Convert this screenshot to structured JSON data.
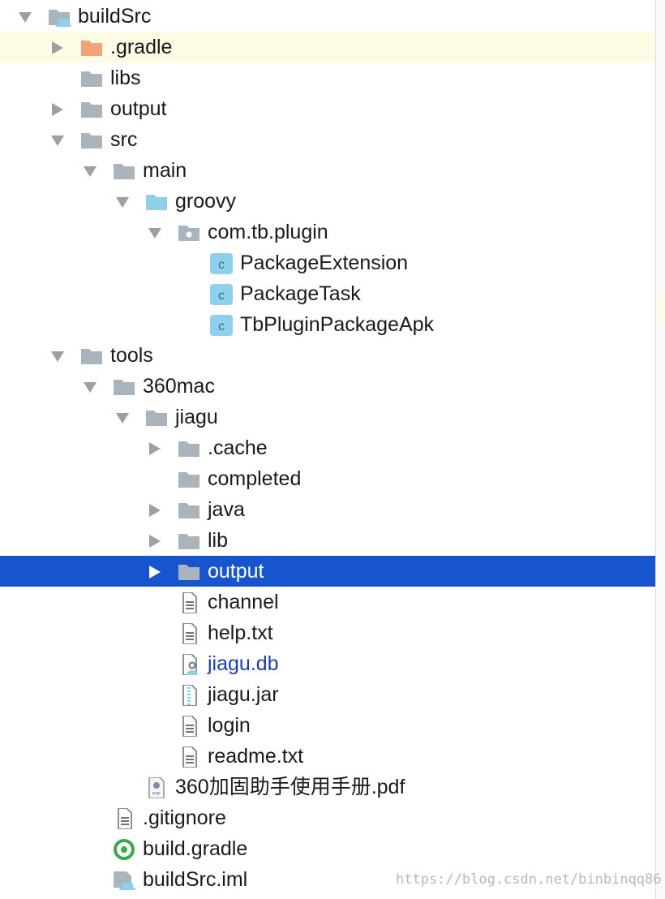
{
  "colors": {
    "selection": "#1755cf",
    "row_highlight": "#fefbe5",
    "folder_gray": "#a9b4bd",
    "folder_orange": "#f0a477",
    "folder_source": "#8fcfea",
    "class_badge": "#8fd0ea",
    "link_text": "#1b3fa8",
    "gradle_green": "#3ea64b"
  },
  "tree": {
    "items": [
      {
        "label": "buildSrc",
        "icon": "module-folder-icon",
        "arrow": "down",
        "depth": 0
      },
      {
        "label": ".gradle",
        "icon": "folder-orange-icon",
        "arrow": "right",
        "depth": 1,
        "highlighted": true
      },
      {
        "label": "libs",
        "icon": "folder-icon",
        "arrow": "none",
        "depth": 1
      },
      {
        "label": "output",
        "icon": "folder-icon",
        "arrow": "right",
        "depth": 1
      },
      {
        "label": "src",
        "icon": "folder-icon",
        "arrow": "down",
        "depth": 1
      },
      {
        "label": "main",
        "icon": "folder-icon",
        "arrow": "down",
        "depth": 2
      },
      {
        "label": "groovy",
        "icon": "source-folder-icon",
        "arrow": "down",
        "depth": 3
      },
      {
        "label": "com.tb.plugin",
        "icon": "package-icon",
        "arrow": "down",
        "depth": 4
      },
      {
        "label": "PackageExtension",
        "icon": "groovy-class-icon",
        "arrow": "none",
        "depth": 5
      },
      {
        "label": "PackageTask",
        "icon": "groovy-class-icon",
        "arrow": "none",
        "depth": 5
      },
      {
        "label": "TbPluginPackageApk",
        "icon": "groovy-class-icon",
        "arrow": "none",
        "depth": 5
      },
      {
        "label": "tools",
        "icon": "folder-icon",
        "arrow": "down",
        "depth": 1
      },
      {
        "label": "360mac",
        "icon": "folder-icon",
        "arrow": "down",
        "depth": 2
      },
      {
        "label": "jiagu",
        "icon": "folder-icon",
        "arrow": "down",
        "depth": 3
      },
      {
        "label": ".cache",
        "icon": "folder-icon",
        "arrow": "right",
        "depth": 4
      },
      {
        "label": "completed",
        "icon": "folder-icon",
        "arrow": "none",
        "depth": 4
      },
      {
        "label": "java",
        "icon": "folder-icon",
        "arrow": "right",
        "depth": 4
      },
      {
        "label": "lib",
        "icon": "folder-icon",
        "arrow": "right",
        "depth": 4
      },
      {
        "label": "output",
        "icon": "folder-icon",
        "arrow": "right",
        "depth": 4,
        "selected": true
      },
      {
        "label": "channel",
        "icon": "text-file-icon",
        "arrow": "none",
        "depth": 4
      },
      {
        "label": "help.txt",
        "icon": "text-file-icon",
        "arrow": "none",
        "depth": 4
      },
      {
        "label": "jiagu.db",
        "icon": "database-file-icon",
        "arrow": "none",
        "depth": 4,
        "link": true
      },
      {
        "label": "jiagu.jar",
        "icon": "jar-file-icon",
        "arrow": "none",
        "depth": 4
      },
      {
        "label": "login",
        "icon": "text-file-icon",
        "arrow": "none",
        "depth": 4
      },
      {
        "label": "readme.txt",
        "icon": "text-file-icon",
        "arrow": "none",
        "depth": 4
      },
      {
        "label": "360加固助手使用手册.pdf",
        "icon": "pdf-file-icon",
        "arrow": "none",
        "depth": 3
      },
      {
        "label": ".gitignore",
        "icon": "text-file-icon",
        "arrow": "none",
        "depth": 2
      },
      {
        "label": "build.gradle",
        "icon": "gradle-icon",
        "arrow": "none",
        "depth": 2
      },
      {
        "label": "buildSrc.iml",
        "icon": "module-file-icon",
        "arrow": "none",
        "depth": 2
      }
    ]
  },
  "watermark": "https://blog.csdn.net/binbinqq86"
}
